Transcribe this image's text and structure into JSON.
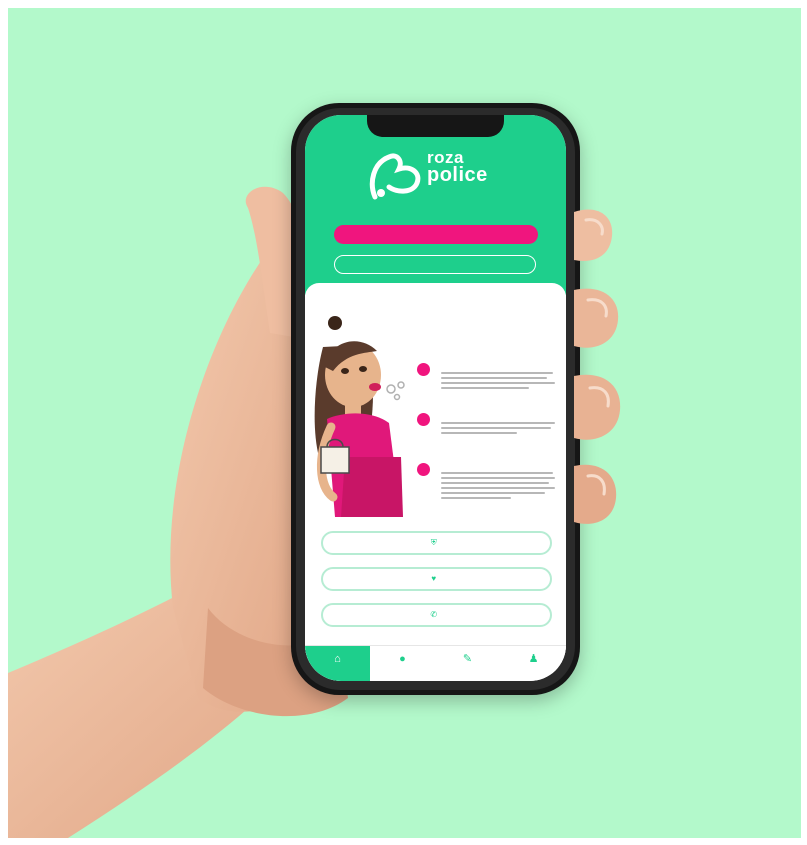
{
  "app": {
    "logo_line1": "roza",
    "logo_line2": "police",
    "logo_tagline": "",
    "primary_button_label": "",
    "secondary_button_label": "",
    "heading": "",
    "features": [
      {
        "number": "",
        "title": ""
      },
      {
        "number": "",
        "title": ""
      },
      {
        "number": "",
        "title": ""
      }
    ],
    "links": [
      {
        "icon": "shield-icon",
        "glyph": "⛨",
        "label": ""
      },
      {
        "icon": "heart-icon",
        "glyph": "♥",
        "label": ""
      },
      {
        "icon": "phone-icon",
        "glyph": "✆",
        "label": ""
      }
    ],
    "tabs": [
      {
        "icon": "home-icon",
        "glyph": "⌂",
        "label": ""
      },
      {
        "icon": "info-icon",
        "glyph": "●",
        "label": ""
      },
      {
        "icon": "pencil-icon",
        "glyph": "✎",
        "label": ""
      },
      {
        "icon": "user-icon",
        "glyph": "♟",
        "label": ""
      }
    ]
  },
  "colors": {
    "background": "#b3f9cb",
    "brand_green": "#1ecf8c",
    "brand_pink": "#f0157e"
  }
}
